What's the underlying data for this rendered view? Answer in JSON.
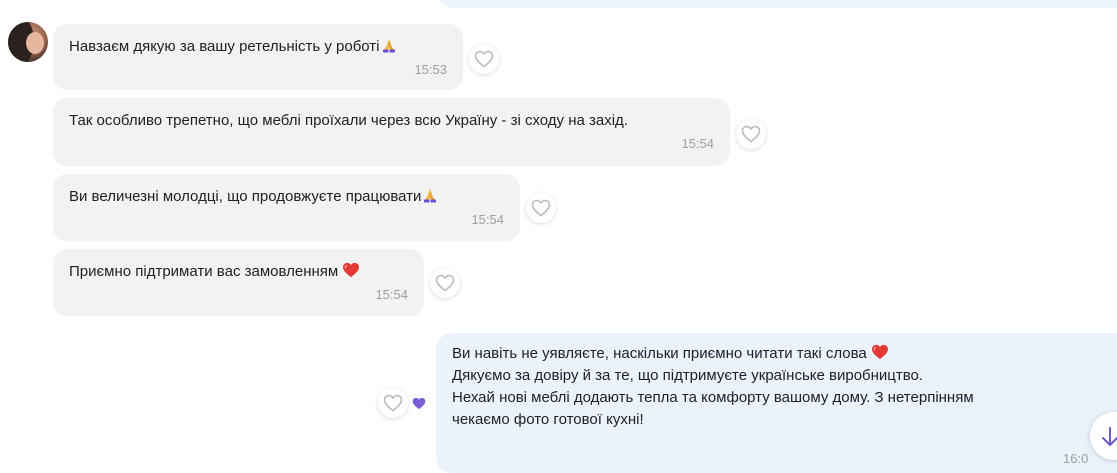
{
  "messages": [
    {
      "text": "Навзаєм дякую за вашу ретельність у роботі",
      "emoji": "pray-icon",
      "time": "15:53"
    },
    {
      "text": "Так особливо трепетно, що меблі проїхали через всю Україну - зі сходу на захід.",
      "time": "15:54"
    },
    {
      "text": "Ви величезні молодці, що продовжуєте працювати",
      "emoji": "pray-icon",
      "time": "15:54"
    },
    {
      "text": "Приємно підтримати вас замовленням",
      "emoji": "red-heart-icon",
      "time": "15:54"
    }
  ],
  "outgoing": {
    "line1": "Ви навіть не уявляєте, наскільки приємно читати такі слова",
    "line1_emoji": "red-heart-icon",
    "line2": "Дякуємо за довіру й за те, що підтримуєте українське виробництво.",
    "line3": "Нехай нові меблі додають тепла та комфорту вашому дому. З нетерпінням",
    "line4": "чекаємо фото готової кухні!",
    "time": "16:0",
    "reaction": "purple-heart-icon"
  },
  "colors": {
    "incoming_bubble": "#f2f2f3",
    "outgoing_bubble": "#ebf2fc",
    "timestamp": "#9aa0a6",
    "reaction_heart": "#7b5cd6",
    "emoji_heart": "#e53935"
  }
}
